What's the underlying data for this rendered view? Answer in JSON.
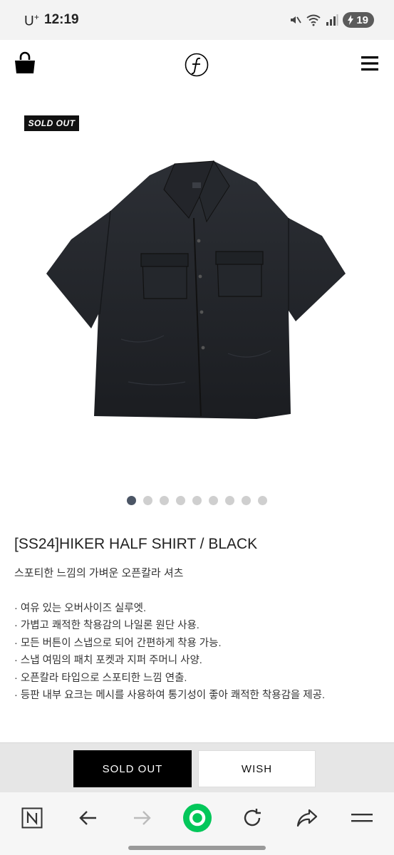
{
  "status_bar": {
    "carrier": "U",
    "carrier_sup": "+",
    "time": "12:19",
    "battery": "19"
  },
  "header": {
    "logo_alt": "brand logo"
  },
  "product": {
    "badge": "SOLD OUT",
    "image_count": 9,
    "active_index": 0,
    "title": "[SS24]HIKER HALF SHIRT / BLACK",
    "subtitle": "스포티한 느낌의 가벼운 오픈칼라 셔츠",
    "features": [
      "· 여유 있는 오버사이즈 실루엣.",
      "· 가볍고 쾌적한 착용감의 나일론 원단 사용.",
      "· 모든 버튼이 스냅으로 되어 간편하게 착용 가능.",
      "· 스냅 여밈의 패치 포켓과 지퍼 주머니 사양.",
      "· 오픈칼라 타입으로 스포티한 느낌 연출.",
      "· 등판 내부 요크는 메시를 사용하여 통기성이 좋아 쾌적한 착용감을 제공."
    ]
  },
  "actions": {
    "sold_out_label": "SOLD OUT",
    "wish_label": "WISH"
  },
  "browser": {
    "icons": [
      "naver-n-icon",
      "back-arrow-icon",
      "forward-arrow-icon",
      "green-home-icon",
      "reload-icon",
      "share-icon",
      "menu-icon"
    ]
  },
  "colors": {
    "accent_green": "#03c75a",
    "badge_bg": "#111111",
    "dot_active": "#4b5565"
  }
}
